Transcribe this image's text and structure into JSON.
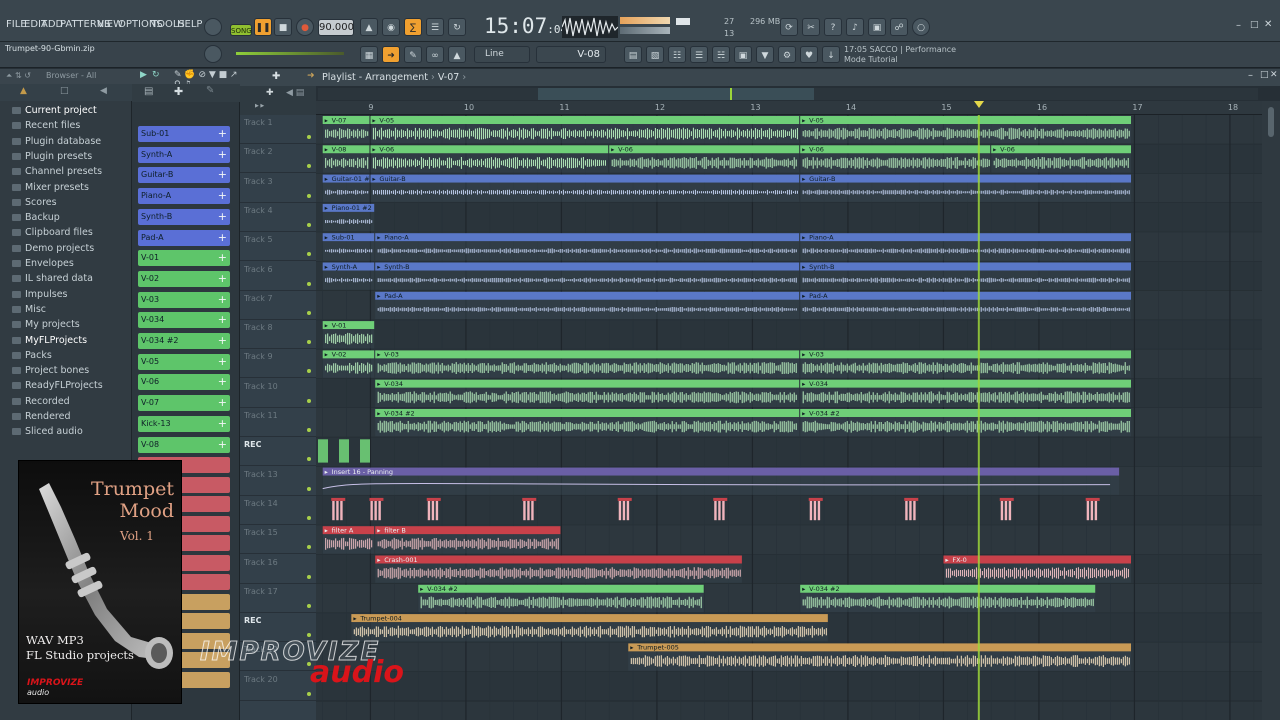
{
  "menu": [
    "FILE",
    "EDIT",
    "ADD",
    "PATTERNS",
    "VIEW",
    "OPTIONS",
    "TOOLS",
    "HELP"
  ],
  "transport": {
    "mode_label": "SONG",
    "tempo": "90.000",
    "time_main": "15:07",
    "time_sub": ":04",
    "monitor_a": "27",
    "monitor_b": "13",
    "memory": "296 MB",
    "snap_mode": "Line",
    "pattern": "V-08"
  },
  "hint_panel": {
    "line1": "17:05  SACCO | Performance",
    "line2": "Mode Tutorial"
  },
  "project_file": "Trumpet-90-Gbmin.zip",
  "browser": {
    "header": "Browser - All",
    "items": [
      {
        "label": "Current project",
        "highlight": true
      },
      {
        "label": "Recent files",
        "highlight": false
      },
      {
        "label": "Plugin database",
        "highlight": false
      },
      {
        "label": "Plugin presets",
        "highlight": false
      },
      {
        "label": "Channel presets",
        "highlight": false
      },
      {
        "label": "Mixer presets",
        "highlight": false
      },
      {
        "label": "Scores",
        "highlight": false
      },
      {
        "label": "Backup",
        "highlight": false
      },
      {
        "label": "Clipboard files",
        "highlight": false
      },
      {
        "label": "Demo projects",
        "highlight": false
      },
      {
        "label": "Envelopes",
        "highlight": false
      },
      {
        "label": "IL shared data",
        "highlight": false
      },
      {
        "label": "Impulses",
        "highlight": false
      },
      {
        "label": "Misc",
        "highlight": false
      },
      {
        "label": "My projects",
        "highlight": false
      },
      {
        "label": "MyFLProjects",
        "highlight": true
      },
      {
        "label": "Packs",
        "highlight": false
      },
      {
        "label": "Project bones",
        "highlight": false
      },
      {
        "label": "ReadyFLProjects",
        "highlight": false
      },
      {
        "label": "Recorded",
        "highlight": false
      },
      {
        "label": "Rendered",
        "highlight": false
      },
      {
        "label": "Sliced audio",
        "highlight": false
      }
    ]
  },
  "channels": [
    {
      "label": "Sub-01",
      "color": "#5a6fd6"
    },
    {
      "label": "Synth-A",
      "color": "#5a6fd6"
    },
    {
      "label": "Guitar-B",
      "color": "#5a6fd6"
    },
    {
      "label": "Piano-A",
      "color": "#5a6fd6"
    },
    {
      "label": "Synth-B",
      "color": "#5a6fd6"
    },
    {
      "label": "Pad-A",
      "color": "#5a6fd6"
    },
    {
      "label": "V-01",
      "color": "#5ec56a"
    },
    {
      "label": "V-02",
      "color": "#5ec56a"
    },
    {
      "label": "V-03",
      "color": "#5ec56a"
    },
    {
      "label": "V-034",
      "color": "#5ec56a"
    },
    {
      "label": "V-034 #2",
      "color": "#5ec56a"
    },
    {
      "label": "V-05",
      "color": "#5ec56a"
    },
    {
      "label": "V-06",
      "color": "#5ec56a"
    },
    {
      "label": "V-07",
      "color": "#5ec56a"
    },
    {
      "label": "Kick-13",
      "color": "#5ec56a"
    },
    {
      "label": "V-08",
      "color": "#5ec56a"
    }
  ],
  "playlist": {
    "title": "Playlist - Arrangement",
    "pattern": "V-07",
    "bars": [
      "9",
      "10",
      "11",
      "12",
      "13",
      "14",
      "15",
      "16",
      "17",
      "18"
    ],
    "tracks": [
      "Track 1",
      "Track 2",
      "Track 3",
      "Track 4",
      "Track 5",
      "Track 6",
      "Track 7",
      "Track 8",
      "Track 9",
      "Track 10",
      "Track 11",
      "REC",
      "Track 13",
      "Track 14",
      "Track 15",
      "Track 16",
      "Track 17",
      "REC",
      "Track 19",
      "Track 20"
    ],
    "clips": [
      {
        "track": 0,
        "start": 8.5,
        "end": 9.0,
        "label": "V-07",
        "kind": "green"
      },
      {
        "track": 0,
        "start": 9.0,
        "end": 13.5,
        "label": "V-05",
        "kind": "green"
      },
      {
        "track": 0,
        "start": 13.5,
        "end": 17.0,
        "label": "V-05",
        "kind": "green"
      },
      {
        "track": 1,
        "start": 8.5,
        "end": 9.0,
        "label": "V-08",
        "kind": "green"
      },
      {
        "track": 1,
        "start": 9.0,
        "end": 11.5,
        "label": "V-06",
        "kind": "green"
      },
      {
        "track": 1,
        "start": 11.5,
        "end": 13.5,
        "label": "V-06",
        "kind": "green"
      },
      {
        "track": 1,
        "start": 13.5,
        "end": 15.5,
        "label": "V-06",
        "kind": "green"
      },
      {
        "track": 1,
        "start": 15.5,
        "end": 17.0,
        "label": "V-06",
        "kind": "green"
      },
      {
        "track": 2,
        "start": 8.5,
        "end": 9.0,
        "label": "Guitar-01 #2",
        "kind": "blue"
      },
      {
        "track": 2,
        "start": 9.0,
        "end": 13.5,
        "label": "Guitar-B",
        "kind": "blue"
      },
      {
        "track": 2,
        "start": 13.5,
        "end": 17.0,
        "label": "Guitar-B",
        "kind": "blue"
      },
      {
        "track": 3,
        "start": 8.5,
        "end": 9.05,
        "label": "Piano-01 #2",
        "kind": "blue"
      },
      {
        "track": 4,
        "start": 8.5,
        "end": 9.05,
        "label": "Sub-01",
        "kind": "blue"
      },
      {
        "track": 4,
        "start": 9.05,
        "end": 13.5,
        "label": "Piano-A",
        "kind": "blue"
      },
      {
        "track": 4,
        "start": 13.5,
        "end": 17.0,
        "label": "Piano-A",
        "kind": "blue"
      },
      {
        "track": 5,
        "start": 8.5,
        "end": 9.05,
        "label": "Synth-A",
        "kind": "blue"
      },
      {
        "track": 5,
        "start": 9.05,
        "end": 13.5,
        "label": "Synth-B",
        "kind": "blue"
      },
      {
        "track": 5,
        "start": 13.5,
        "end": 17.0,
        "label": "Synth-B",
        "kind": "blue"
      },
      {
        "track": 6,
        "start": 9.05,
        "end": 13.5,
        "label": "Pad-A",
        "kind": "blue"
      },
      {
        "track": 6,
        "start": 13.5,
        "end": 17.0,
        "label": "Pad-A",
        "kind": "blue"
      },
      {
        "track": 7,
        "start": 8.5,
        "end": 9.05,
        "label": "V-01",
        "kind": "green"
      },
      {
        "track": 8,
        "start": 8.5,
        "end": 9.05,
        "label": "V-02",
        "kind": "green"
      },
      {
        "track": 8,
        "start": 9.05,
        "end": 13.5,
        "label": "V-03",
        "kind": "green"
      },
      {
        "track": 8,
        "start": 13.5,
        "end": 17.0,
        "label": "V-03",
        "kind": "green"
      },
      {
        "track": 9,
        "start": 9.05,
        "end": 13.5,
        "label": "V-034",
        "kind": "green"
      },
      {
        "track": 9,
        "start": 13.5,
        "end": 17.0,
        "label": "V-034",
        "kind": "green"
      },
      {
        "track": 10,
        "start": 9.05,
        "end": 13.5,
        "label": "V-034 #2",
        "kind": "green"
      },
      {
        "track": 10,
        "start": 13.5,
        "end": 17.0,
        "label": "V-034 #2",
        "kind": "green"
      },
      {
        "track": 12,
        "start": 8.5,
        "end": 16.85,
        "label": "Insert 16 - Panning",
        "kind": "purple"
      },
      {
        "track": 14,
        "start": 8.5,
        "end": 9.05,
        "label": "filter A",
        "kind": "red"
      },
      {
        "track": 14,
        "start": 9.05,
        "end": 11.0,
        "label": "filter B",
        "kind": "red"
      },
      {
        "track": 15,
        "start": 9.05,
        "end": 12.9,
        "label": "Crash-001",
        "kind": "red"
      },
      {
        "track": 15,
        "start": 15.0,
        "end": 17.0,
        "label": "FX-0",
        "kind": "red"
      },
      {
        "track": 16,
        "start": 9.5,
        "end": 12.5,
        "label": "V-034 #2",
        "kind": "green"
      },
      {
        "track": 16,
        "start": 13.5,
        "end": 16.6,
        "label": "V-034 #2",
        "kind": "green"
      },
      {
        "track": 17,
        "start": 8.8,
        "end": 13.8,
        "label": "Trumpet-004",
        "kind": "orange"
      },
      {
        "track": 18,
        "start": 11.7,
        "end": 17.0,
        "label": "Trumpet-005",
        "kind": "orange"
      }
    ]
  },
  "cover": {
    "title_line1": "Trumpet",
    "title_line2": "Mood",
    "vol": "Vol. 1",
    "formats_line1": "WAV MP3",
    "formats_line2": "FL Studio projects",
    "brand_a": "IMPROVIZE",
    "brand_b": "audio"
  },
  "watermark": {
    "line1": "IMPROVIZE",
    "line2": "audio"
  },
  "colors": {
    "green": "#6fcf78",
    "blue": "#5a78c8",
    "purple": "#6a5fa6",
    "red": "#c8414a",
    "orange": "#c99a55",
    "playhead": "#9cd63a"
  }
}
